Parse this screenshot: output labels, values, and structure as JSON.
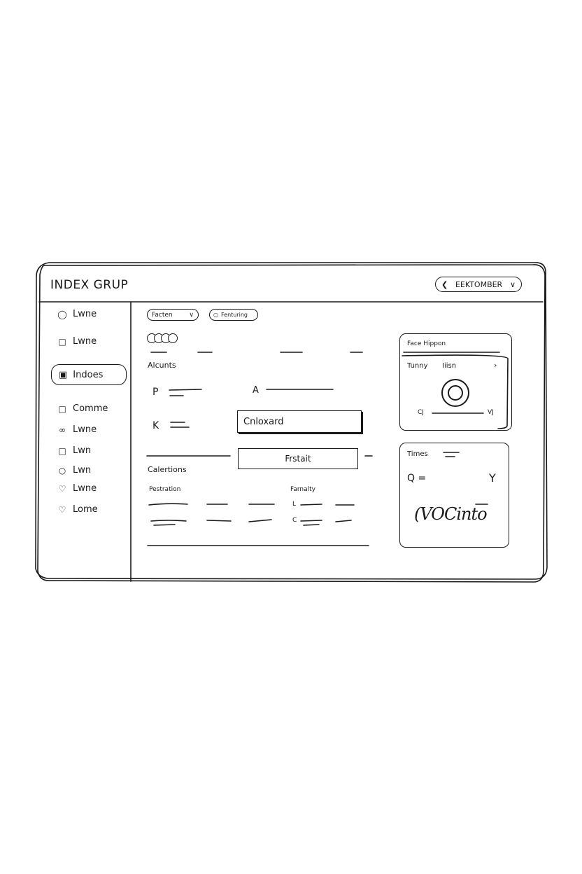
{
  "app": {
    "title": "INDEX GRUP",
    "month_selector": {
      "prev_icon": "chevron-left-icon",
      "label": "EEKTOMBER",
      "dropdown_icon": "chevron-down-icon"
    }
  },
  "sidebar": {
    "items": [
      {
        "label": "Lwne",
        "icon": "tag-icon"
      },
      {
        "label": "Lwne",
        "icon": "bookmark-icon"
      },
      {
        "label": "Indoes",
        "icon": "lock-icon",
        "active": true
      },
      {
        "label": "Comme",
        "icon": "chat-icon"
      },
      {
        "label": "Lwne",
        "icon": "link-icon"
      },
      {
        "label": "Lwn",
        "icon": "clipboard-icon"
      },
      {
        "label": "Lwn",
        "icon": "clock-icon"
      },
      {
        "label": "Lwne",
        "icon": "heart-icon"
      },
      {
        "label": "Lome",
        "icon": "heart-icon"
      }
    ]
  },
  "toolbar": {
    "dropdown_label": "Facten",
    "filter_label": "Fenturing"
  },
  "main": {
    "accounts_heading": "Alcunts",
    "field_p_label": "P",
    "field_a_label": "A",
    "field_k_label": "K",
    "input_value": "Cnloxard",
    "button_label": "Frstait",
    "calculations_heading": "Calertions",
    "table": {
      "col1": "Pestration",
      "col2": "Farnalty",
      "row_markers": [
        "L",
        "C"
      ]
    }
  },
  "card_face": {
    "title": "Face Hippon",
    "left_label": "Tunny",
    "right_label": "Iiisn",
    "next_icon": "chevron-right-icon",
    "min_label": "CJ",
    "max_label": "VJ"
  },
  "card_times": {
    "title": "Times",
    "q_label": "Q =",
    "y_label": "Y",
    "signature": "(VOCinto"
  }
}
